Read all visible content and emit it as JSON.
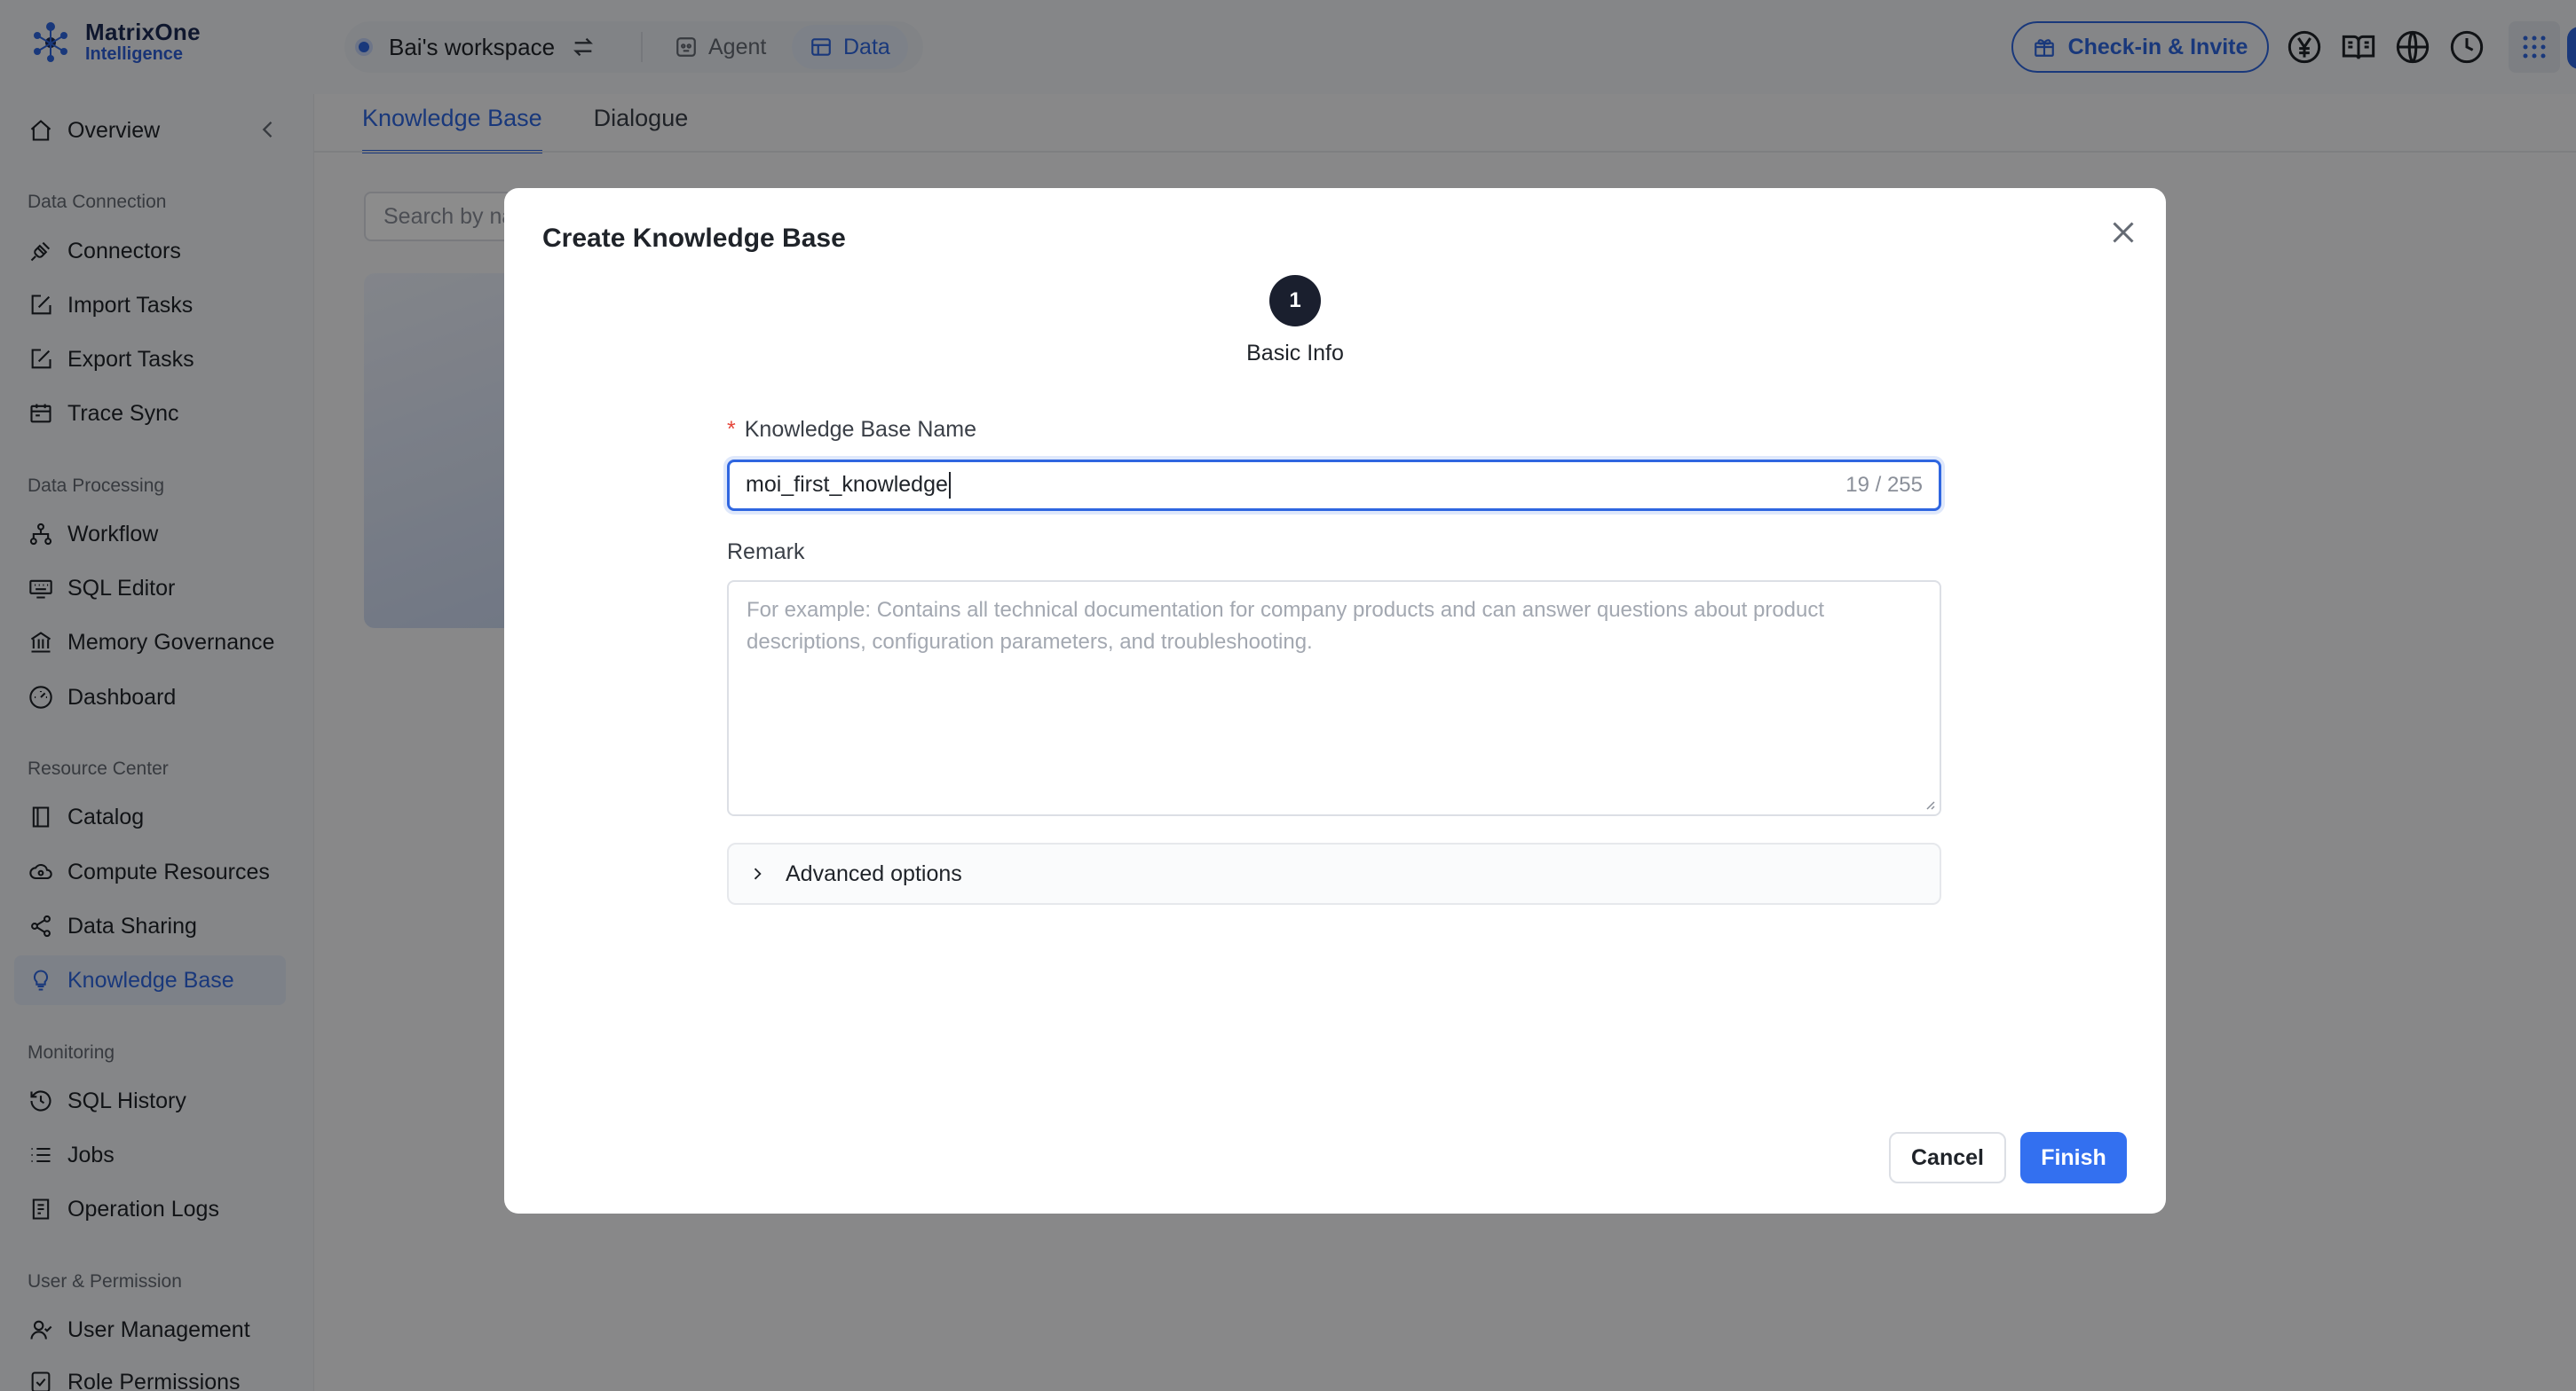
{
  "app": {
    "logo_line1": "MatrixOne",
    "logo_line2": "Intelligence",
    "workspace_name": "Bai's workspace",
    "nav_tabs": [
      {
        "label": "Agent",
        "active": false
      },
      {
        "label": "Data",
        "active": true
      }
    ],
    "checkin_label": "Check-in & Invite",
    "top_icons": [
      "yen-icon",
      "book-icon",
      "globe-icon",
      "clock-icon",
      "apps-grid-icon"
    ],
    "accent_color": "#2f66e0"
  },
  "sidebar": {
    "overview_label": "Overview",
    "sections": [
      {
        "title": "Data Connection",
        "items": [
          {
            "label": "Connectors",
            "icon": "plug-icon"
          },
          {
            "label": "Import Tasks",
            "icon": "edit-square-icon"
          },
          {
            "label": "Export Tasks",
            "icon": "edit-square-icon"
          },
          {
            "label": "Trace Sync",
            "icon": "calendar-icon"
          }
        ]
      },
      {
        "title": "Data Processing",
        "items": [
          {
            "label": "Workflow",
            "icon": "workflow-icon"
          },
          {
            "label": "SQL Editor",
            "icon": "keyboard-icon"
          },
          {
            "label": "Memory Governance",
            "icon": "bank-icon"
          },
          {
            "label": "Dashboard",
            "icon": "gauge-icon"
          }
        ]
      },
      {
        "title": "Resource Center",
        "items": [
          {
            "label": "Catalog",
            "icon": "book-icon"
          },
          {
            "label": "Compute Resources",
            "icon": "cloud-icon"
          },
          {
            "label": "Data Sharing",
            "icon": "share-icon"
          },
          {
            "label": "Knowledge Base",
            "icon": "bulb-icon",
            "active": true
          }
        ]
      },
      {
        "title": "Monitoring",
        "items": [
          {
            "label": "SQL History",
            "icon": "history-icon"
          },
          {
            "label": "Jobs",
            "icon": "list-icon"
          },
          {
            "label": "Operation Logs",
            "icon": "log-icon"
          }
        ]
      },
      {
        "title": "User & Permission",
        "items": [
          {
            "label": "User Management",
            "icon": "user-icon"
          },
          {
            "label": "Role Permissions",
            "icon": "shield-check-icon"
          }
        ]
      }
    ]
  },
  "main": {
    "tabs": [
      {
        "label": "Knowledge Base",
        "active": true
      },
      {
        "label": "Dialogue",
        "active": false
      }
    ],
    "search_placeholder": "Search by na"
  },
  "modal": {
    "title": "Create Knowledge Base",
    "step_number": "1",
    "step_label": "Basic Info",
    "name_label": "Knowledge Base Name",
    "required_mark": "*",
    "name_value": "moi_first_knowledge",
    "name_counter": "19 / 255",
    "remark_label": "Remark",
    "remark_placeholder": "For example: Contains all technical documentation for company products and can answer questions about product descriptions, configuration parameters, and troubleshooting.",
    "advanced_label": "Advanced options",
    "cancel_label": "Cancel",
    "finish_label": "Finish",
    "finish_color": "#3370f0"
  }
}
